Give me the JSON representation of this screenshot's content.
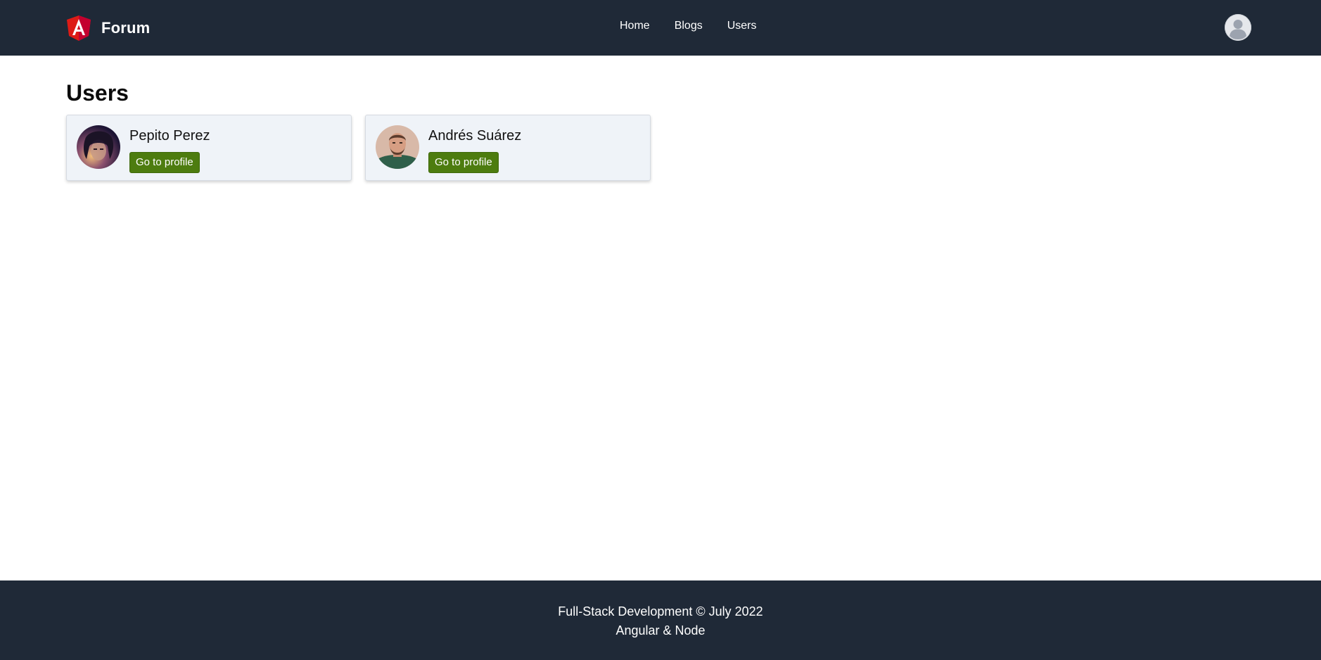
{
  "header": {
    "brand_name": "Forum",
    "logo_icon": "angular-logo-icon",
    "nav": [
      {
        "label": "Home"
      },
      {
        "label": "Blogs"
      },
      {
        "label": "Users"
      }
    ],
    "account_icon": "user-avatar-icon"
  },
  "main": {
    "title": "Users",
    "users": [
      {
        "name": "Pepito Perez",
        "button_label": "Go to profile",
        "avatar_icon": "user-photo"
      },
      {
        "name": "Andrés Suárez",
        "button_label": "Go to profile",
        "avatar_icon": "user-photo"
      }
    ]
  },
  "footer": {
    "line1": "Full-Stack Development © July 2022",
    "line2": "Angular & Node"
  },
  "colors": {
    "header_bg": "#1f2937",
    "footer_bg": "#1f2937",
    "card_bg": "#eff3f8",
    "button_bg": "#4d7c0f",
    "logo_red": "#dd1b16"
  }
}
